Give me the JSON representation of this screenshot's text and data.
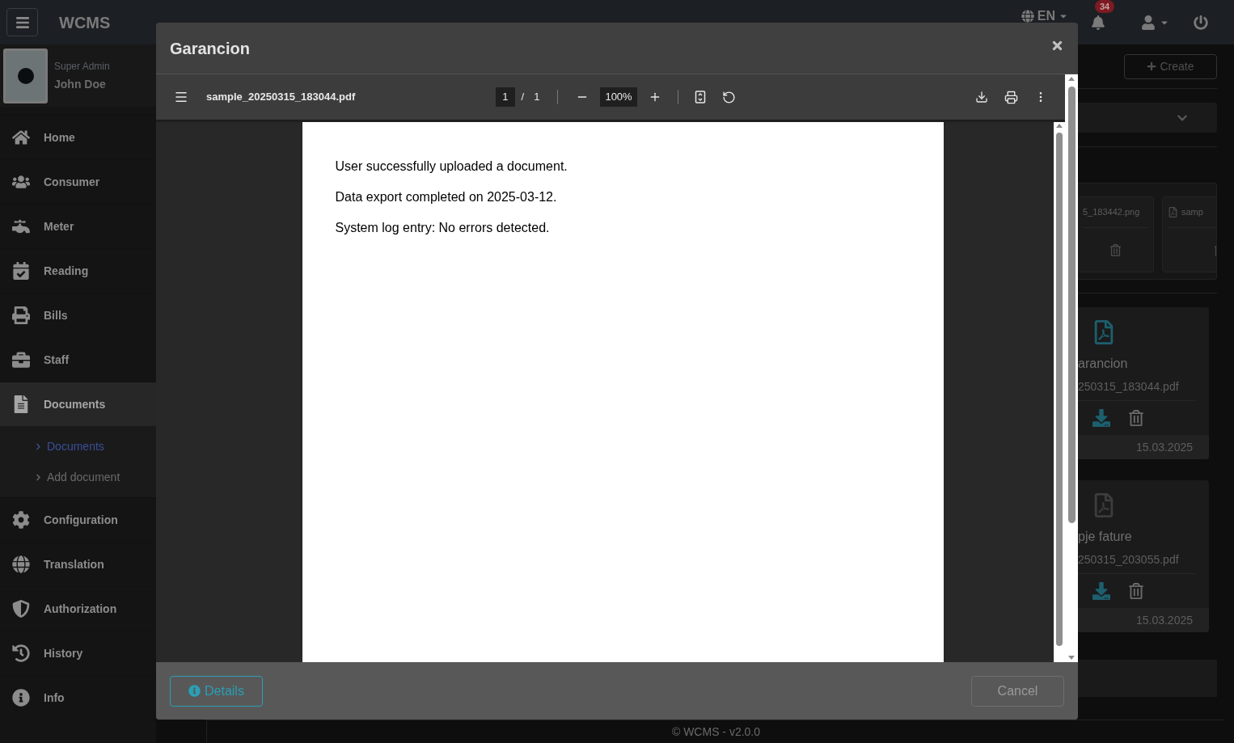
{
  "topbar": {
    "brand": "WCMS",
    "language": "EN",
    "notification_count": "34"
  },
  "sidebar": {
    "user": {
      "role": "Super Admin",
      "name": "John Doe"
    },
    "items": [
      {
        "label": "Home",
        "selected": false
      },
      {
        "label": "Consumer",
        "selected": false
      },
      {
        "label": "Meter",
        "selected": false
      },
      {
        "label": "Reading",
        "selected": false
      },
      {
        "label": "Bills",
        "selected": false
      },
      {
        "label": "Staff",
        "selected": false
      },
      {
        "label": "Documents",
        "selected": true,
        "expanded": true,
        "children": [
          {
            "label": "Documents",
            "selected": true
          },
          {
            "label": "Add document",
            "selected": false
          }
        ]
      },
      {
        "label": "Configuration",
        "selected": false
      },
      {
        "label": "Translation",
        "selected": false
      },
      {
        "label": "Authorization",
        "selected": false
      },
      {
        "label": "History",
        "selected": false
      },
      {
        "label": "Info",
        "selected": false
      }
    ]
  },
  "main": {
    "create_button": "Create",
    "image_cards": [
      {
        "kind": "image",
        "filename": "5_183442.png"
      },
      {
        "kind": "pdf",
        "filename": "samp"
      }
    ],
    "documents": [
      {
        "title": "arancion",
        "filename": "250315_183044.pdf",
        "date": "15.03.2025",
        "active": true
      },
      {
        "title": "pje fature",
        "filename": "250315_203055.pdf",
        "date": "15.03.2025",
        "active": false
      }
    ]
  },
  "footer": "© WCMS - v2.0.0",
  "modal": {
    "title": "Garancion",
    "viewer": {
      "filename": "sample_20250315_183044.pdf",
      "page": "1",
      "page_separator": "/",
      "page_count": "1",
      "zoom": "100%",
      "lines": [
        "User successfully uploaded a document.",
        "Data export completed on 2025-03-12.",
        "System log entry: No errors detected."
      ]
    },
    "details_button": "Details",
    "cancel_button": {
      "label": "Cancel",
      "disabled": true
    }
  }
}
